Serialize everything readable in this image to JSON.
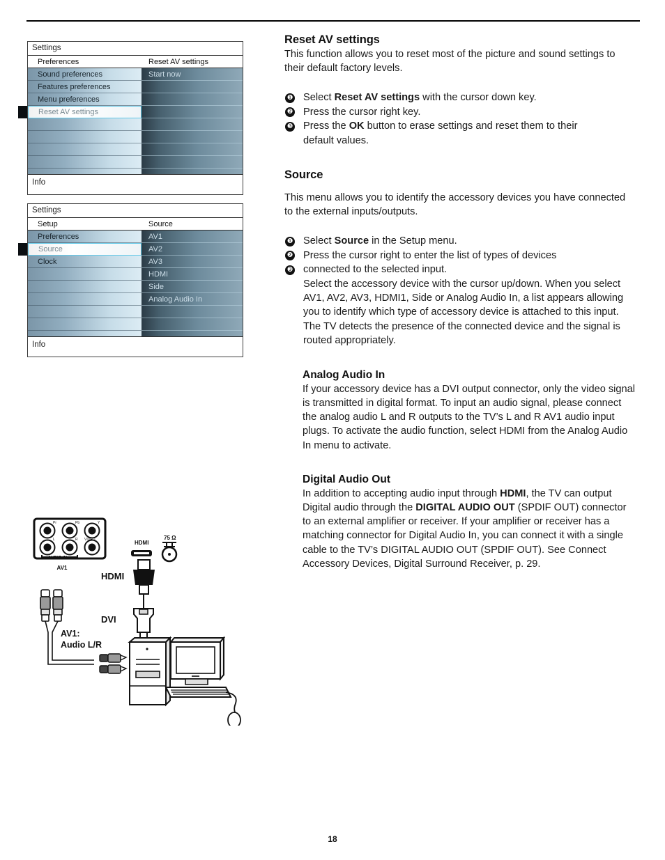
{
  "page": {
    "number": "18"
  },
  "menus": [
    {
      "name": "reset-av-settings-menu",
      "title": "Settings",
      "left_column_header": "Preferences",
      "right_column_header": "Reset AV settings",
      "left_items": [
        {
          "label": "Sound preferences",
          "selected": false
        },
        {
          "label": "Features preferences",
          "selected": false
        },
        {
          "label": "Menu preferences",
          "selected": false
        },
        {
          "label": "Reset AV settings",
          "selected": true
        }
      ],
      "right_items": [
        {
          "label": "Start now"
        }
      ],
      "info_label": "Info"
    },
    {
      "name": "source-menu",
      "title": "Settings",
      "left_column_header": "Setup",
      "right_column_header": "Source",
      "left_items": [
        {
          "label": "Preferences",
          "selected": false
        },
        {
          "label": "Source",
          "selected": true
        },
        {
          "label": "Clock",
          "selected": false
        }
      ],
      "right_items": [
        {
          "label": "AV1"
        },
        {
          "label": "AV2"
        },
        {
          "label": "AV3"
        },
        {
          "label": "HDMI"
        },
        {
          "label": "Side"
        },
        {
          "label": "Analog Audio In"
        }
      ],
      "info_label": "Info"
    }
  ],
  "sections": {
    "reset_av": {
      "heading": "Reset AV settings",
      "intro": "This function allows you to reset most of the picture and sound settings to their default factory levels.",
      "steps": [
        {
          "num": "❶",
          "html": "Select <b class=\"k\">Reset AV settings</b> with the cursor down key."
        },
        {
          "num": "❷",
          "html": "Press the cursor right key."
        },
        {
          "num": "❸",
          "html": "Press the <b class=\"k\">OK</b> button to erase settings and reset them to their"
        }
      ],
      "step3_continuation": "default values."
    },
    "source": {
      "heading": "Source",
      "intro": "This menu allows you to identify the accessory devices you have connected to the external inputs/outputs.",
      "steps": [
        {
          "num": "❶",
          "html": "Select <b class=\"k\">Source</b> in the Setup menu."
        },
        {
          "num": "❷",
          "html": "Press the cursor right to enter the list of types of devices"
        },
        {
          "num": "❸",
          "html": "connected to the selected input."
        }
      ],
      "continuation": "Select the accessory device with the cursor up/down. When you select AV1, AV2, AV3, HDMI1, Side or Analog Audio In, a list appears allowing you to identify which type of accessory device is attached to this input. The TV detects the presence of the connected device and the signal is routed appropriately."
    },
    "analog_audio_in": {
      "heading": "Analog Audio In",
      "body": "If your accessory device has a DVI output connector, only the video signal is transmitted in digital format.  To input an audio signal, please connect the analog audio L and R outputs to the TV’s L and R AV1 audio input plugs.  To activate the audio function, select  HDMI from the Analog Audio In menu to activate."
    },
    "digital_audio_out": {
      "heading": "Digital Audio Out",
      "body_html": "In addition to accepting audio input through <b class=\"k\">HDMI</b>, the TV can output Digital audio through the <b class=\"k\">DIGITAL AUDIO OUT</b> (SPDIF OUT) connector to an external amplifier or receiver. If your amplifier or receiver has a matching connector for Digital Audio In, you can connect it with a single cable to the TV’s DIGITAL AUDIO OUT (SPDIF OUT). See Connect Accessory Devices, Digital Surround Receiver, p. 29."
    }
  },
  "diagram": {
    "name": "dvi-to-hdmi-connection-diagram",
    "jack_labels_top": [
      "Pr",
      "Pb",
      "Y"
    ],
    "jack_labels_bottom": [
      "L",
      "R",
      "VIDEO"
    ],
    "audio_in_label": "AUDIO IN",
    "panel_label": "AV1",
    "hdmi_port_label": "HDMI",
    "antenna_label": "75 Ω",
    "hdmi_cable_label": "HDMI",
    "dvi_label": "DVI",
    "rca_label_line1": "AV1:",
    "rca_label_line2": "Audio L/R"
  }
}
